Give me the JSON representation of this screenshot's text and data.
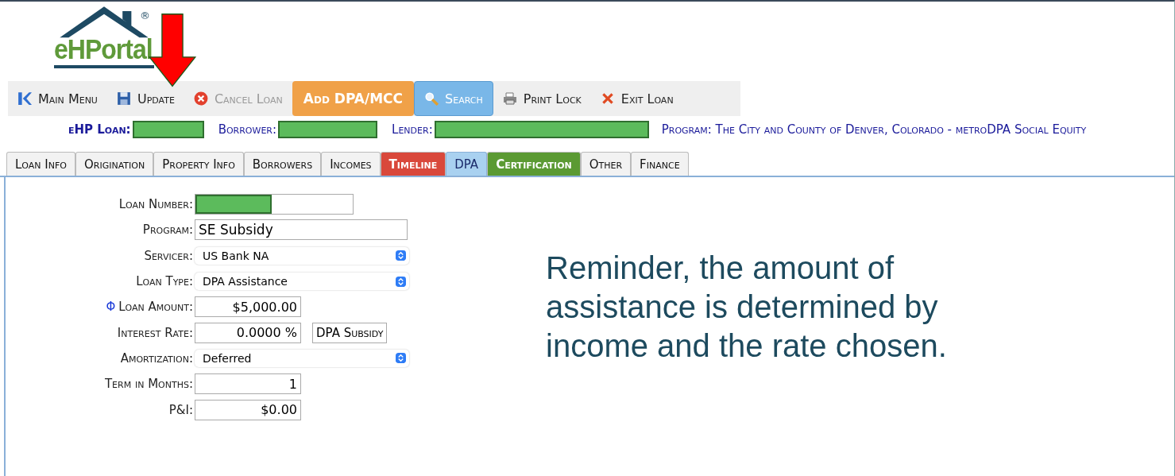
{
  "logo": {
    "text": "eHPortal",
    "mark": "®"
  },
  "toolbar": [
    {
      "label": "Main Menu",
      "kind": "plain"
    },
    {
      "label": "Update",
      "kind": "plain"
    },
    {
      "label": "Cancel Loan",
      "kind": "disabled"
    },
    {
      "label": "Add DPA/MCC",
      "kind": "orange"
    },
    {
      "label": "Search",
      "kind": "blue"
    },
    {
      "label": "Print Lock",
      "kind": "plain"
    },
    {
      "label": "Exit Loan",
      "kind": "plain"
    }
  ],
  "loan_header": {
    "fields": [
      {
        "label": "eHP Loan:"
      },
      {
        "label": "Borrower:"
      },
      {
        "label": "Lender:"
      }
    ],
    "program": "Program: The City and County of Denver, Colorado - metroDPA Social Equity"
  },
  "tabs": [
    {
      "label": "Loan Info",
      "selected": false
    },
    {
      "label": "Origination",
      "selected": false
    },
    {
      "label": "Property Info",
      "selected": false
    },
    {
      "label": "Borrowers",
      "selected": false
    },
    {
      "label": "Incomes",
      "selected": false
    },
    {
      "label": "Timeline",
      "selected": false,
      "color": "#d9483b"
    },
    {
      "label": "DPA",
      "selected": true,
      "color": "#a9d1f0"
    },
    {
      "label": "Certification",
      "selected": false,
      "color": "#5b9a33"
    },
    {
      "label": "Other",
      "selected": false
    },
    {
      "label": "Finance",
      "selected": false
    }
  ],
  "form": [
    {
      "label": "Loan Number:",
      "kind": "redacted"
    },
    {
      "label": "Program:",
      "kind": "text",
      "value": "SE Subsidy"
    },
    {
      "label": "Servicer:",
      "kind": "select",
      "value": "US Bank NA"
    },
    {
      "label": "Loan Type:",
      "kind": "select",
      "value": "DPA Assistance"
    },
    {
      "label": "Loan Amount:",
      "kind": "amount",
      "value": "$5,000.00",
      "marker": "Φ"
    },
    {
      "label": "Interest Rate:",
      "kind": "amount",
      "value": "0.0000 %",
      "button": "DPA Subsidy"
    },
    {
      "label": "Amortization:",
      "kind": "select",
      "value": "Deferred"
    },
    {
      "label": "Term in Months:",
      "kind": "amount",
      "value": "1"
    },
    {
      "label": "P&I:",
      "kind": "amount",
      "value": "$0.00"
    }
  ],
  "reminder": "Reminder, the amount of assistance is determined by income and the rate chosen."
}
